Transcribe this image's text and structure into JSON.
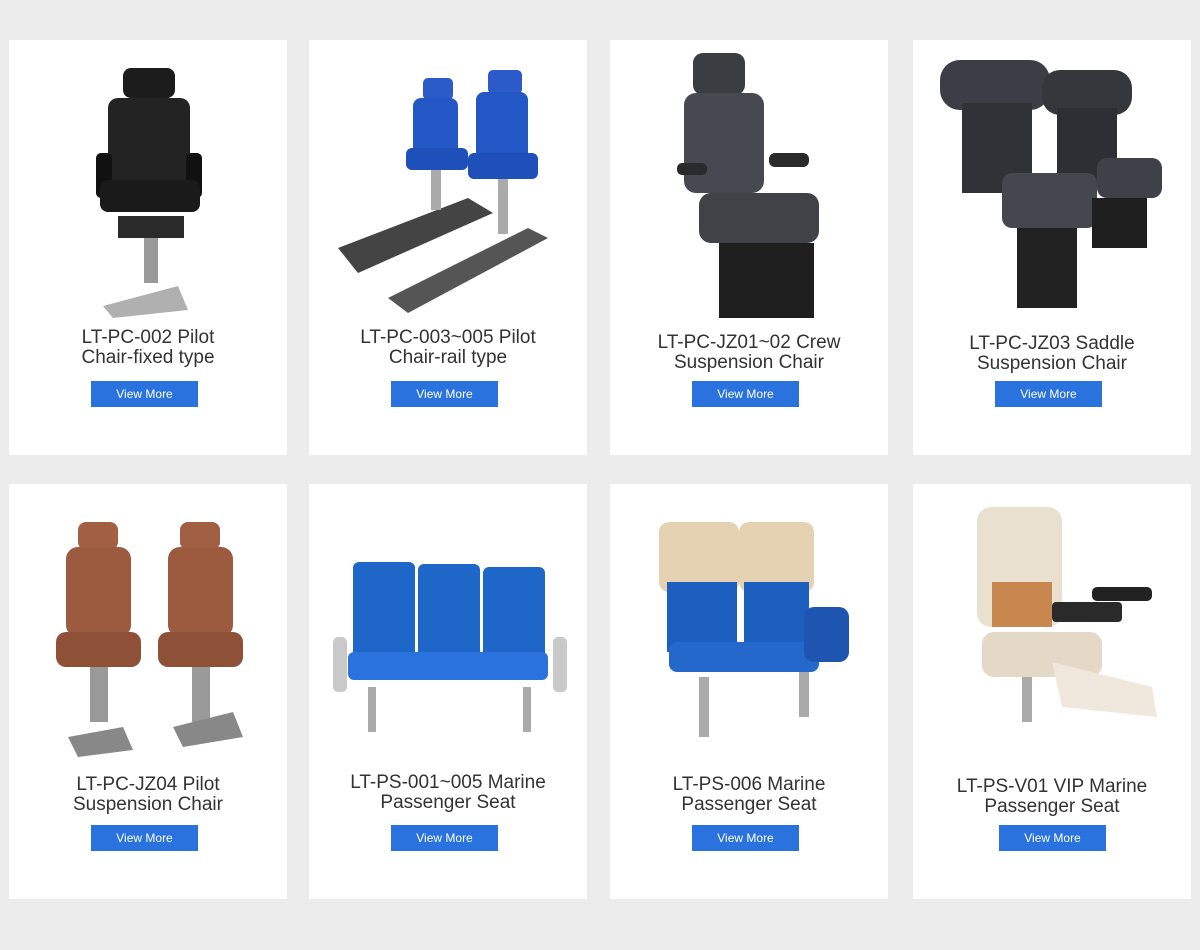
{
  "colors": {
    "background": "#ececec",
    "card": "#ffffff",
    "button": "#2a72dd",
    "text": "#333333"
  },
  "products": [
    {
      "title_line1": "LT-PC-002 Pilot",
      "title_line2": "Chair-fixed type",
      "button": "View More",
      "image_icon": "black-pilot-chair-icon"
    },
    {
      "title_line1": "LT-PC-003~005 Pilot",
      "title_line2": "Chair-rail type",
      "button": "View More",
      "image_icon": "blue-rail-chairs-icon"
    },
    {
      "title_line1": "LT-PC-JZ01~02 Crew",
      "title_line2": "Suspension Chair",
      "button": "View More",
      "image_icon": "grey-crew-chair-icon"
    },
    {
      "title_line1": "LT-PC-JZ03 Saddle",
      "title_line2": "Suspension Chair",
      "button": "View More",
      "image_icon": "saddle-chairs-icon"
    },
    {
      "title_line1": "LT-PC-JZ04 Pilot",
      "title_line2": "Suspension Chair",
      "button": "View More",
      "image_icon": "brown-pilot-chairs-icon"
    },
    {
      "title_line1": "LT-PS-001~005 Marine",
      "title_line2": "Passenger Seat",
      "button": "View More",
      "image_icon": "blue-bench-seats-icon"
    },
    {
      "title_line1": "LT-PS-006 Marine",
      "title_line2": "Passenger Seat",
      "button": "View More",
      "image_icon": "beige-blue-seats-icon"
    },
    {
      "title_line1": "LT-PS-V01 VIP Marine",
      "title_line2": "Passenger Seat",
      "button": "View More",
      "image_icon": "vip-recliner-seat-icon"
    }
  ]
}
